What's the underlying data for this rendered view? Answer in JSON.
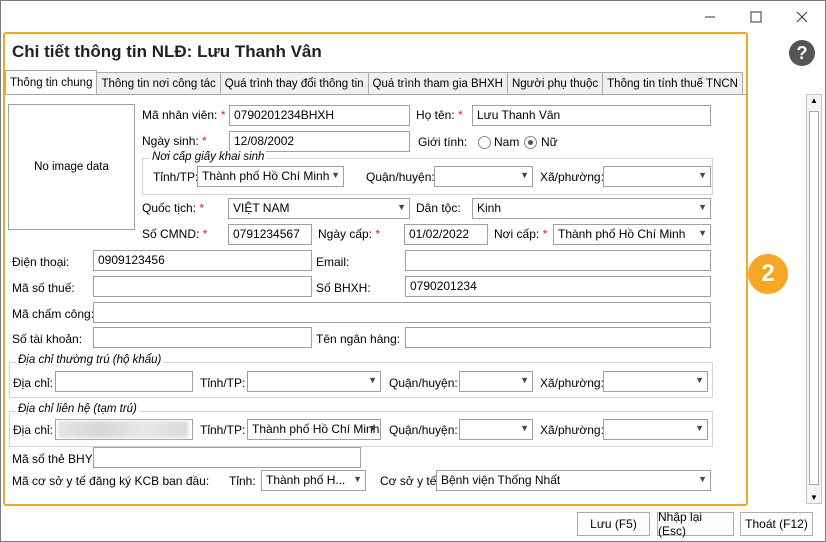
{
  "window": {
    "title": "Chi tiết thông tin NLĐ: Lưu Thanh Vân"
  },
  "tabs": [
    "Thông tin chung",
    "Thông tin nơi công tác",
    "Quá trình thay đổi thông tin",
    "Quá trình tham gia BHXH",
    "Người phụ thuộc",
    "Thông tin tính thuế TNCN"
  ],
  "photo": {
    "text": "No image data"
  },
  "form": {
    "ma_nv_label": "Mã nhân viên:",
    "ma_nv": "0790201234BHXH",
    "ho_ten_label": "Họ tên:",
    "ho_ten": "Lưu Thanh Vân",
    "ngay_sinh_label": "Ngày sinh:",
    "ngay_sinh": "12/08/2002",
    "gioi_tinh_label": "Giới tính:",
    "gioi_tinh_nam": "Nam",
    "gioi_tinh_nu": "Nữ",
    "noi_cap_ks_title": "Nơi cấp giấy khai sinh",
    "tinh_label": "Tỉnh/TP:",
    "ks_tinh": "Thành phố Hồ Chí Minh",
    "quan_label": "Quận/huyện:",
    "xa_label": "Xã/phường:",
    "quoc_tich_label": "Quốc tịch:",
    "quoc_tich": "VIỆT NAM",
    "dan_toc_label": "Dân tộc:",
    "dan_toc": "Kinh",
    "cmnd_label": "Số CMND:",
    "cmnd": "0791234567",
    "ngay_cap_label": "Ngày cấp:",
    "ngay_cap": "01/02/2022",
    "noi_cap_label": "Nơi cấp:",
    "noi_cap": "Thành phố Hồ Chí Minh",
    "dien_thoai_label": "Điện thoại:",
    "dien_thoai": "0909123456",
    "email_label": "Email:",
    "ma_so_thue_label": "Mã số thuế:",
    "so_bhxh_label": "Số BHXH:",
    "so_bhxh": "0790201234",
    "ma_cham_cong_label": "Mã chấm công:",
    "so_tai_khoan_label": "Số tài khoản:",
    "ten_ngan_hang_label": "Tên ngân hàng:",
    "thuong_tru_title": "Địa chỉ thường trú (hộ khẩu)",
    "dia_chi_label": "Địa chỉ:",
    "lien_he_title": "Địa chỉ liên hệ (tạm trú)",
    "lh_tinh": "Thành phố Hồ Chí Minh",
    "bhyt_label": "Mã số thẻ BHYT:",
    "kcb_label": "Mã cơ sở y tế đăng ký KCB ban đầu:",
    "kcb_tinh_label": "Tỉnh:",
    "kcb_tinh": "Thành phố H...",
    "co_so_label": "Cơ sở y tế:",
    "co_so": "Bệnh viện Thống Nhất"
  },
  "badge": "2",
  "buttons": {
    "save": "Lưu (F5)",
    "reset": "Nhập lại (Esc)",
    "exit": "Thoát (F12)"
  },
  "colors": {
    "highlight": "#f5a623",
    "required": "#e02020"
  }
}
